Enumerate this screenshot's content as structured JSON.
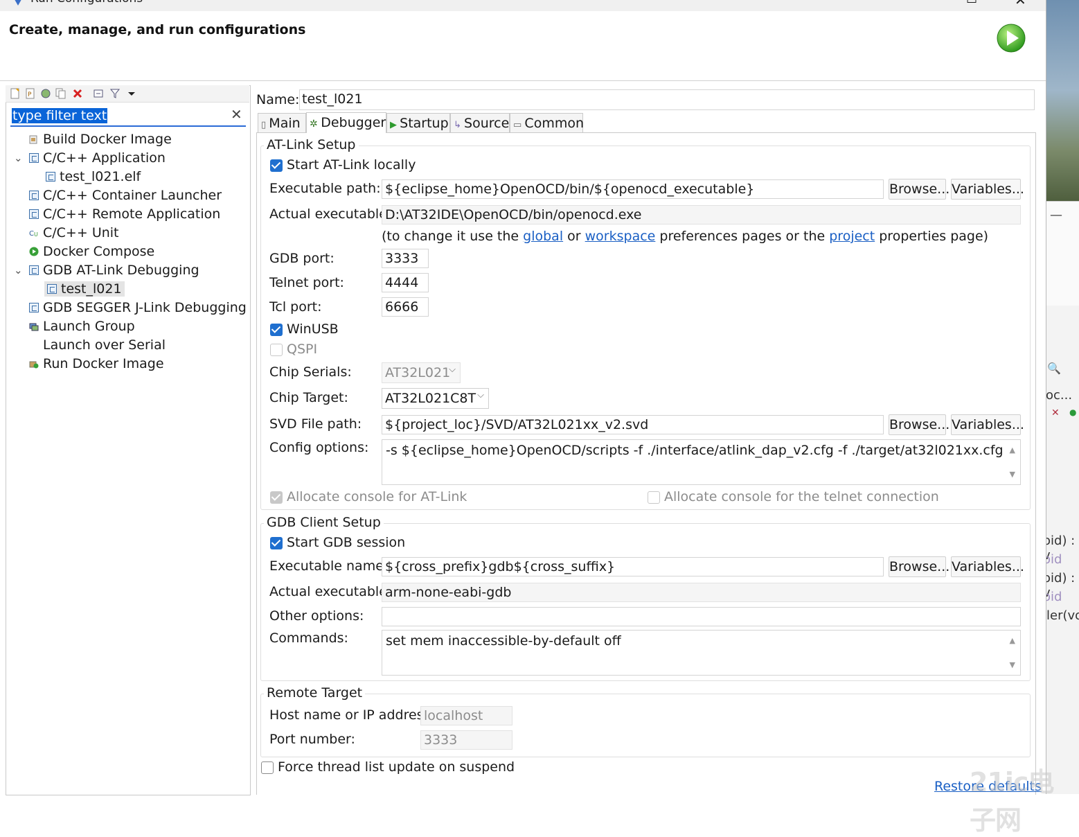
{
  "window": {
    "title": "Run Configurations"
  },
  "header": {
    "text": "Create, manage, and run configurations"
  },
  "filter": {
    "text": "type filter text"
  },
  "tree": {
    "items": [
      {
        "label": "Build Docker Image"
      },
      {
        "label": "C/C++ Application"
      },
      {
        "label": "test_l021.elf"
      },
      {
        "label": "C/C++ Container Launcher"
      },
      {
        "label": "C/C++ Remote Application"
      },
      {
        "label": "C/C++ Unit"
      },
      {
        "label": "Docker Compose"
      },
      {
        "label": "GDB AT-Link Debugging"
      },
      {
        "label": "test_l021"
      },
      {
        "label": "GDB SEGGER J-Link Debugging"
      },
      {
        "label": "Launch Group"
      },
      {
        "label": "Launch over Serial"
      },
      {
        "label": "Run Docker Image"
      }
    ]
  },
  "name": {
    "label": "Name:",
    "value": "test_l021"
  },
  "tabs": [
    "Main",
    "Debugger",
    "Startup",
    "Source",
    "Common"
  ],
  "atlink": {
    "title": "AT-Link Setup",
    "start_locally": "Start AT-Link locally",
    "exec_path_label": "Executable path:",
    "exec_path": "${eclipse_home}OpenOCD/bin/${openocd_executable}",
    "actual_label": "Actual executable:",
    "actual": "D:\\AT32IDE\\OpenOCD/bin/openocd.exe",
    "hint_pre": "(to change it use the",
    "hint_global": "global",
    "hint_or": "or",
    "hint_workspace": "workspace",
    "hint_mid": "preferences pages or the",
    "hint_project": "project",
    "hint_post": "properties page)",
    "gdb_port_label": "GDB port:",
    "gdb_port": "3333",
    "telnet_port_label": "Telnet port:",
    "telnet_port": "4444",
    "tcl_port_label": "Tcl port:",
    "tcl_port": "6666",
    "winusb": "WinUSB",
    "qspi": "QSPI",
    "chip_serials_label": "Chip Serials:",
    "chip_serials": "AT32L021",
    "chip_target_label": "Chip Target:",
    "chip_target": "AT32L021C8T",
    "svd_label": "SVD File path:",
    "svd": "${project_loc}/SVD/AT32L021xx_v2.svd",
    "config_label": "Config options:",
    "config": "-s ${eclipse_home}OpenOCD/scripts -f ./interface/atlink_dap_v2.cfg -f ./target/at32l021xx.cfg",
    "alloc_console": "Allocate console for AT-Link",
    "alloc_telnet": "Allocate console for the telnet connection"
  },
  "gdb": {
    "title": "GDB Client Setup",
    "start_session": "Start GDB session",
    "exec_name_label": "Executable name:",
    "exec_name": "${cross_prefix}gdb${cross_suffix}",
    "actual_label": "Actual executable:",
    "actual": "arm-none-eabi-gdb",
    "other_label": "Other options:",
    "other": "",
    "commands_label": "Commands:",
    "commands": "set mem inaccessible-by-default off"
  },
  "remote": {
    "title": "Remote Target",
    "host_label": "Host name or IP address:",
    "host": "localhost",
    "port_label": "Port number:",
    "port": "3333"
  },
  "buttons": {
    "browse": "Browse...",
    "variables": "Variables..."
  },
  "force_thread": "Force thread list update on suspend",
  "restore": "Restore defaults",
  "background": {
    "lines": [
      "oc...",
      "oid) : v",
      "oid",
      "oid) : v",
      "oid",
      "ller(vo"
    ]
  },
  "watermark": "21ic电子网"
}
